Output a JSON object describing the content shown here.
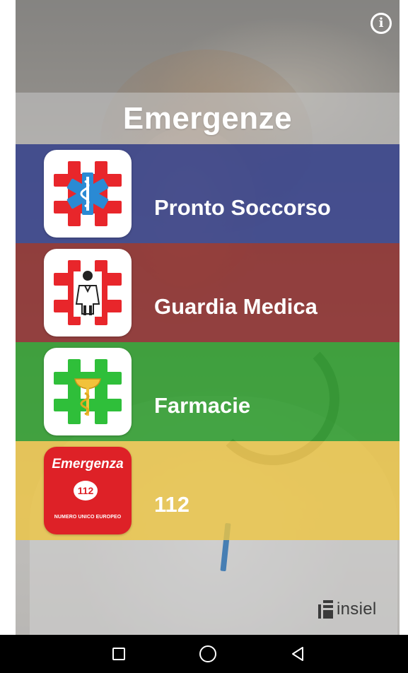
{
  "header": {
    "title": "Emergenze",
    "info_icon": "info-icon"
  },
  "rows": [
    {
      "label": "Pronto Soccorso",
      "icon": "pronto-soccorso-icon",
      "color": "#3c478c"
    },
    {
      "label": "Guardia Medica",
      "icon": "guardia-medica-icon",
      "color": "#8b2f2f"
    },
    {
      "label": "Farmacie",
      "icon": "farmacie-icon",
      "color": "#2e9b2e"
    },
    {
      "label": "112",
      "icon": "emergenza-112-icon",
      "color": "#e6c24a"
    }
  ],
  "icon_112": {
    "top_text": "Emergenza",
    "badge_text": "112",
    "bottom_text": "NUMERO UNICO EUROPEO"
  },
  "brand": {
    "name": "insiel",
    "icon": "insiel-logo"
  },
  "navbar": {
    "icons": [
      "recents-icon",
      "home-icon",
      "back-icon"
    ]
  },
  "colors": {
    "cross_red": "#e8262b",
    "cross_green": "#2fbf3a",
    "star_of_life_blue": "#2a8ad4",
    "icon_112_red": "#de2127"
  }
}
